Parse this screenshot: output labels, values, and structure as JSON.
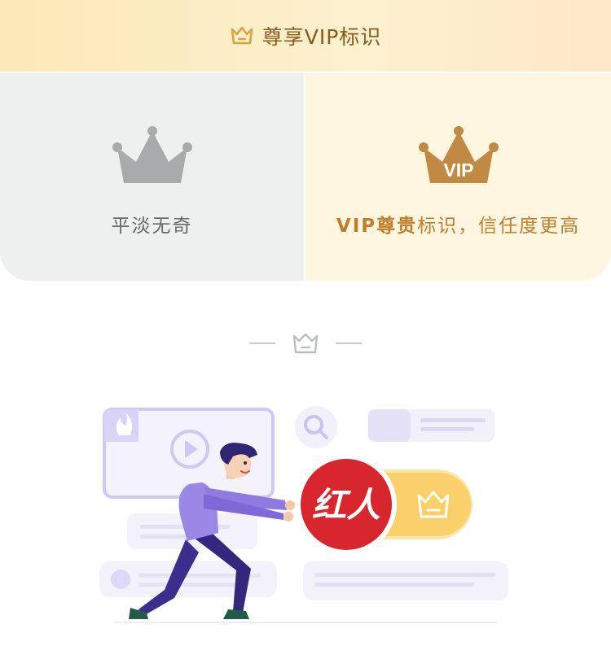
{
  "header": {
    "title": "尊享VIP标识",
    "icon": "crown-icon",
    "accent": "#d9a441"
  },
  "comparison": {
    "left": {
      "icon": "crown-gray-icon",
      "label": "平淡无奇",
      "color": "#a9aaab"
    },
    "right": {
      "icon": "crown-vip-icon",
      "badge": "VIP",
      "label_strong": "VIP尊贵",
      "label_rest": "标识，信任度更高",
      "color": "#c08a45"
    }
  },
  "divider": {
    "icon": "crown-outline-icon"
  },
  "illustration": {
    "badge_text": "红人",
    "badge_color": "#d8262e",
    "pill_icon": "crown-icon",
    "pill_color": "#f9c74a"
  }
}
